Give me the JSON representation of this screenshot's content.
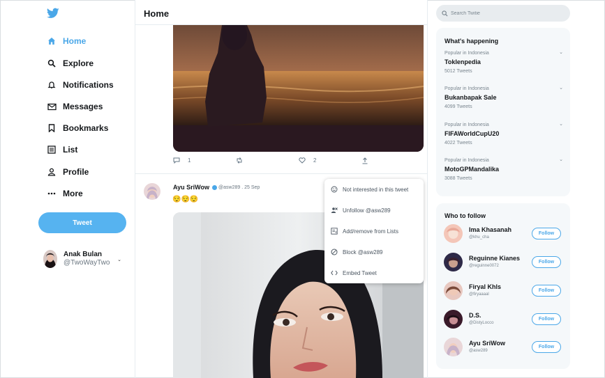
{
  "sidebar": {
    "logo": "twitter-bird-icon",
    "nav": [
      {
        "label": "Home",
        "icon": "home-icon",
        "active": true
      },
      {
        "label": "Explore",
        "icon": "search-icon"
      },
      {
        "label": "Notifications",
        "icon": "bell-icon"
      },
      {
        "label": "Messages",
        "icon": "envelope-icon"
      },
      {
        "label": "Bookmarks",
        "icon": "bookmark-icon"
      },
      {
        "label": "List",
        "icon": "list-icon"
      },
      {
        "label": "Profile",
        "icon": "person-icon"
      },
      {
        "label": "More",
        "icon": "more-dots-icon"
      }
    ],
    "tweet_button": "Tweet",
    "account": {
      "name": "Anak Bulan",
      "handle": "@TwoWayTwo"
    }
  },
  "main": {
    "title": "Home",
    "tweet1": {
      "replies": "1",
      "likes": "2"
    },
    "tweet2": {
      "name": "Ayu SriWow",
      "meta": "@asw289 . 25 Sep",
      "text": "😌😌😌"
    }
  },
  "menu": {
    "items": [
      {
        "label": "Not interested in this tweet",
        "icon": "frown-icon"
      },
      {
        "label": "Unfollow @asw289",
        "icon": "unfollow-user-icon"
      },
      {
        "label": "Add/remove from Lists",
        "icon": "list-add-icon"
      },
      {
        "label": "Block @asw289",
        "icon": "block-icon"
      },
      {
        "label": "Embed Tweet",
        "icon": "code-icon"
      }
    ]
  },
  "search": {
    "placeholder": "Search Twitie"
  },
  "trends": {
    "title": "What's happening",
    "items": [
      {
        "context": "Popular in Indonesia",
        "tag": "Toklenpedia",
        "count": "5012 Tweets"
      },
      {
        "context": "Popular in Indonesia",
        "tag": "Bukanbapak Sale",
        "count": "4099 Tweets"
      },
      {
        "context": "Popular in Indonesia",
        "tag": "FIFAWorldCupU20",
        "count": "4022 Tweets"
      },
      {
        "context": "Popular in Indonesia",
        "tag": "MotoGPMandalika",
        "count": "3088 Tweets"
      }
    ]
  },
  "who_to_follow": {
    "title": "Who to follow",
    "follow_label": "Follow",
    "items": [
      {
        "name": "Ima Khasanah",
        "handle": "@khu_cha"
      },
      {
        "name": "Reguinne Kianes",
        "handle": "@reguinne0072"
      },
      {
        "name": "Firyal Khls",
        "handle": "@firyaaaal"
      },
      {
        "name": "D.S.",
        "handle": "@DistyLocco"
      },
      {
        "name": "Ayu SriWow",
        "handle": "@asw289"
      }
    ]
  },
  "colors": {
    "accent": "#4aa7e8",
    "tweet_button": "#56b3f0"
  }
}
